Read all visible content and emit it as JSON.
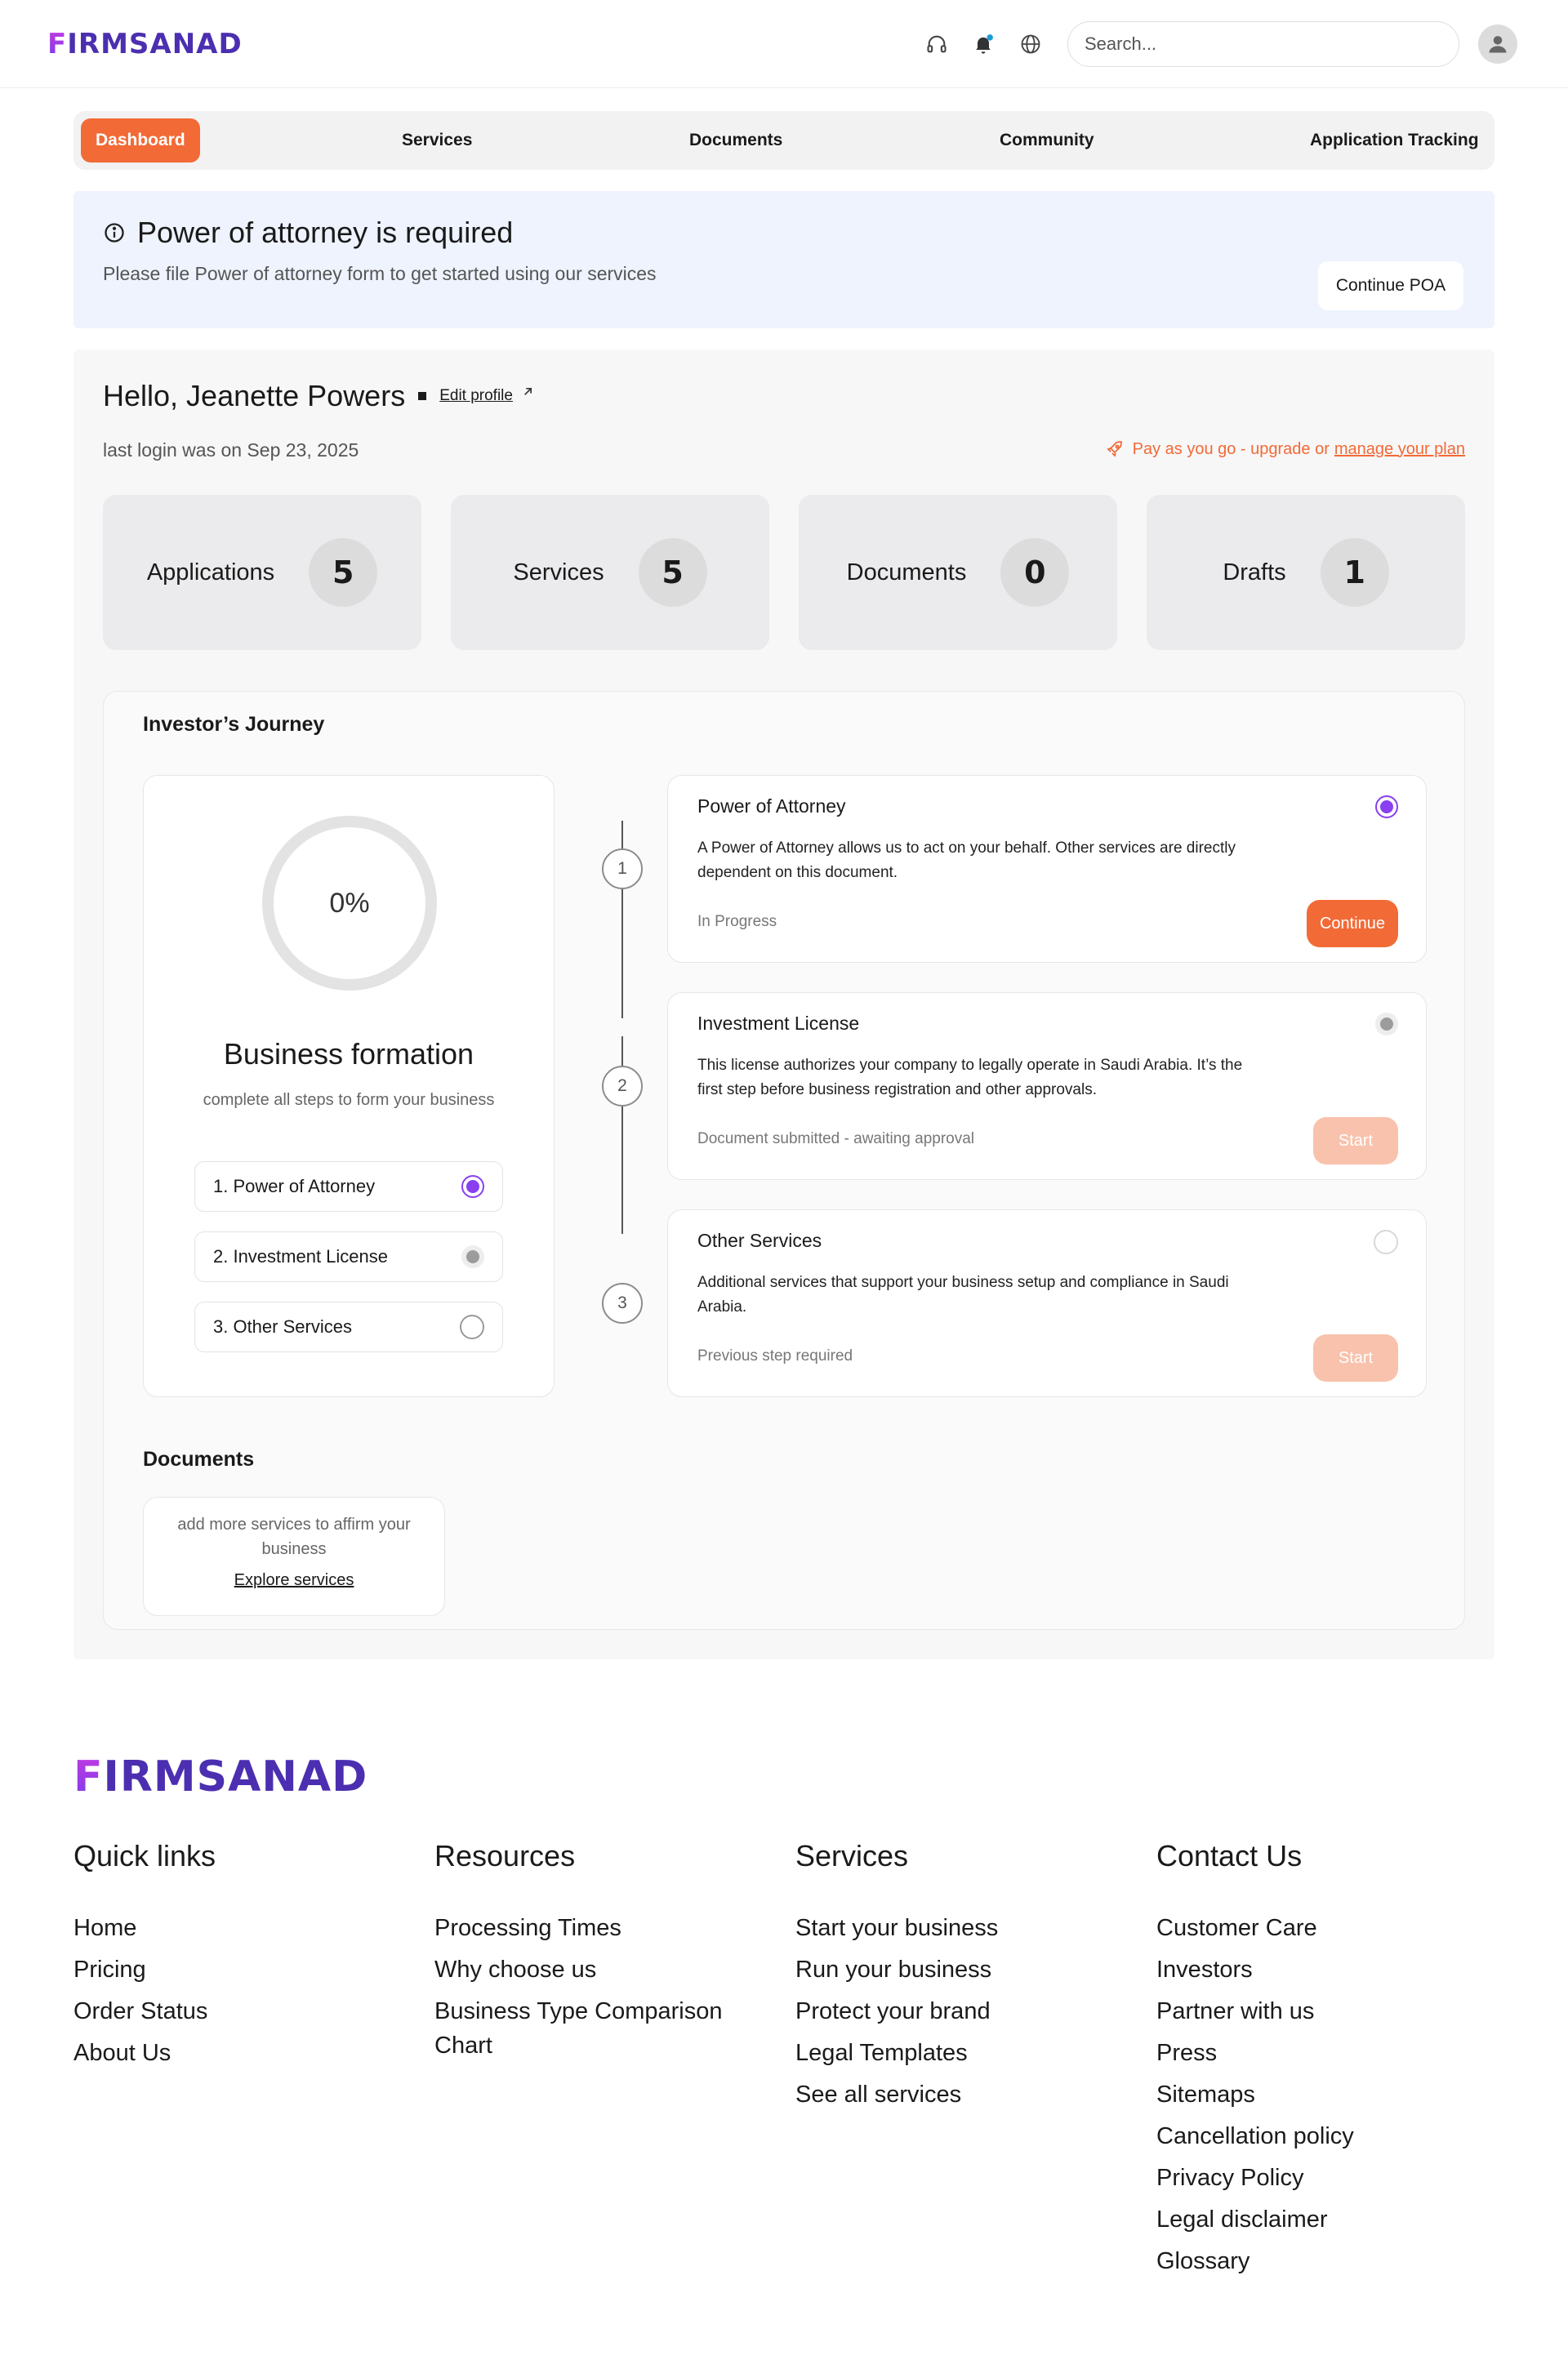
{
  "header": {
    "logo_text": "FIRMSANAD",
    "search_placeholder": "Search...",
    "icons": [
      "headset-icon",
      "bell-icon",
      "globe-icon",
      "user-icon"
    ],
    "notification_dot_color": "#1a9bd8"
  },
  "tabs": [
    {
      "label": "Dashboard",
      "active": true
    },
    {
      "label": "Services",
      "active": false
    },
    {
      "label": "Documents",
      "active": false
    },
    {
      "label": "Community",
      "active": false
    },
    {
      "label": "Application Tracking",
      "active": false
    }
  ],
  "banner": {
    "title": "Power of attorney is required",
    "subtitle": "Please file Power of attorney form to get started using our services",
    "button": "Continue POA"
  },
  "profile": {
    "greeting": "Hello, Jeanette Powers",
    "edit_link": "Edit profile",
    "last_login": "last login was on Sep 23, 2025",
    "plan_text": "Pay as you go - upgrade or",
    "plan_link": "manage your plan"
  },
  "stats": [
    {
      "label": "Applications",
      "value": "5"
    },
    {
      "label": "Services",
      "value": "5"
    },
    {
      "label": "Documents",
      "value": "0"
    },
    {
      "label": "Drafts",
      "value": "1"
    }
  ],
  "journey": {
    "title": "Investor’s Journey",
    "progress_text": "0%",
    "progress_fraction": 0,
    "formation_title": "Business formation",
    "formation_subtitle": "complete all steps to form your business",
    "steps": [
      {
        "label": "1. Power of Attorney",
        "state": "active"
      },
      {
        "label": "2. Investment License",
        "state": "submitted"
      },
      {
        "label": "3. Other Services",
        "state": "pending"
      }
    ],
    "timeline_numbers": [
      "1",
      "2",
      "3"
    ],
    "cards": [
      {
        "title": "Power of Attorney",
        "description": "A Power of Attorney allows us to act on your behalf. Other services are directly dependent on this document.",
        "status": "In Progress",
        "button": "Continue"
      },
      {
        "title": "Investment License",
        "description": "This license authorizes your company to legally operate in Saudi Arabia. It’s the first step before business registration and other approvals.",
        "status": "Document submitted - awaiting approval",
        "button": "Start"
      },
      {
        "title": "Other Services",
        "description": "Additional services that support your business setup and compliance in Saudi Arabia.",
        "status": "Previous step required",
        "button": "Start"
      }
    ]
  },
  "documents": {
    "title": "Documents",
    "empty_text": "add more services to affirm your business",
    "link": "Explore services"
  },
  "footer": {
    "logo_text": "FIRMSANAD",
    "columns": [
      {
        "heading": "Quick links",
        "links": [
          "Home",
          "Pricing",
          "Order Status",
          "About Us"
        ]
      },
      {
        "heading": "Resources",
        "links": [
          "Processing Times",
          "Why choose us",
          "Business Type Comparison Chart"
        ]
      },
      {
        "heading": "Services",
        "links": [
          "Start your business",
          "Run your business",
          "Protect your brand",
          "Legal Templates",
          "See all services"
        ]
      },
      {
        "heading": "Contact Us",
        "links": [
          "Customer Care",
          "Investors",
          "Partner with us",
          "Press",
          "Sitemaps",
          "Cancellation policy",
          "Privacy Policy",
          "Legal disclaimer",
          "Glossary"
        ]
      }
    ]
  },
  "colors": {
    "accent": "#f26a36",
    "brand": "#4b2fb0",
    "active_step": "#8a3ff0",
    "banner_bg": "#eef3fe"
  }
}
